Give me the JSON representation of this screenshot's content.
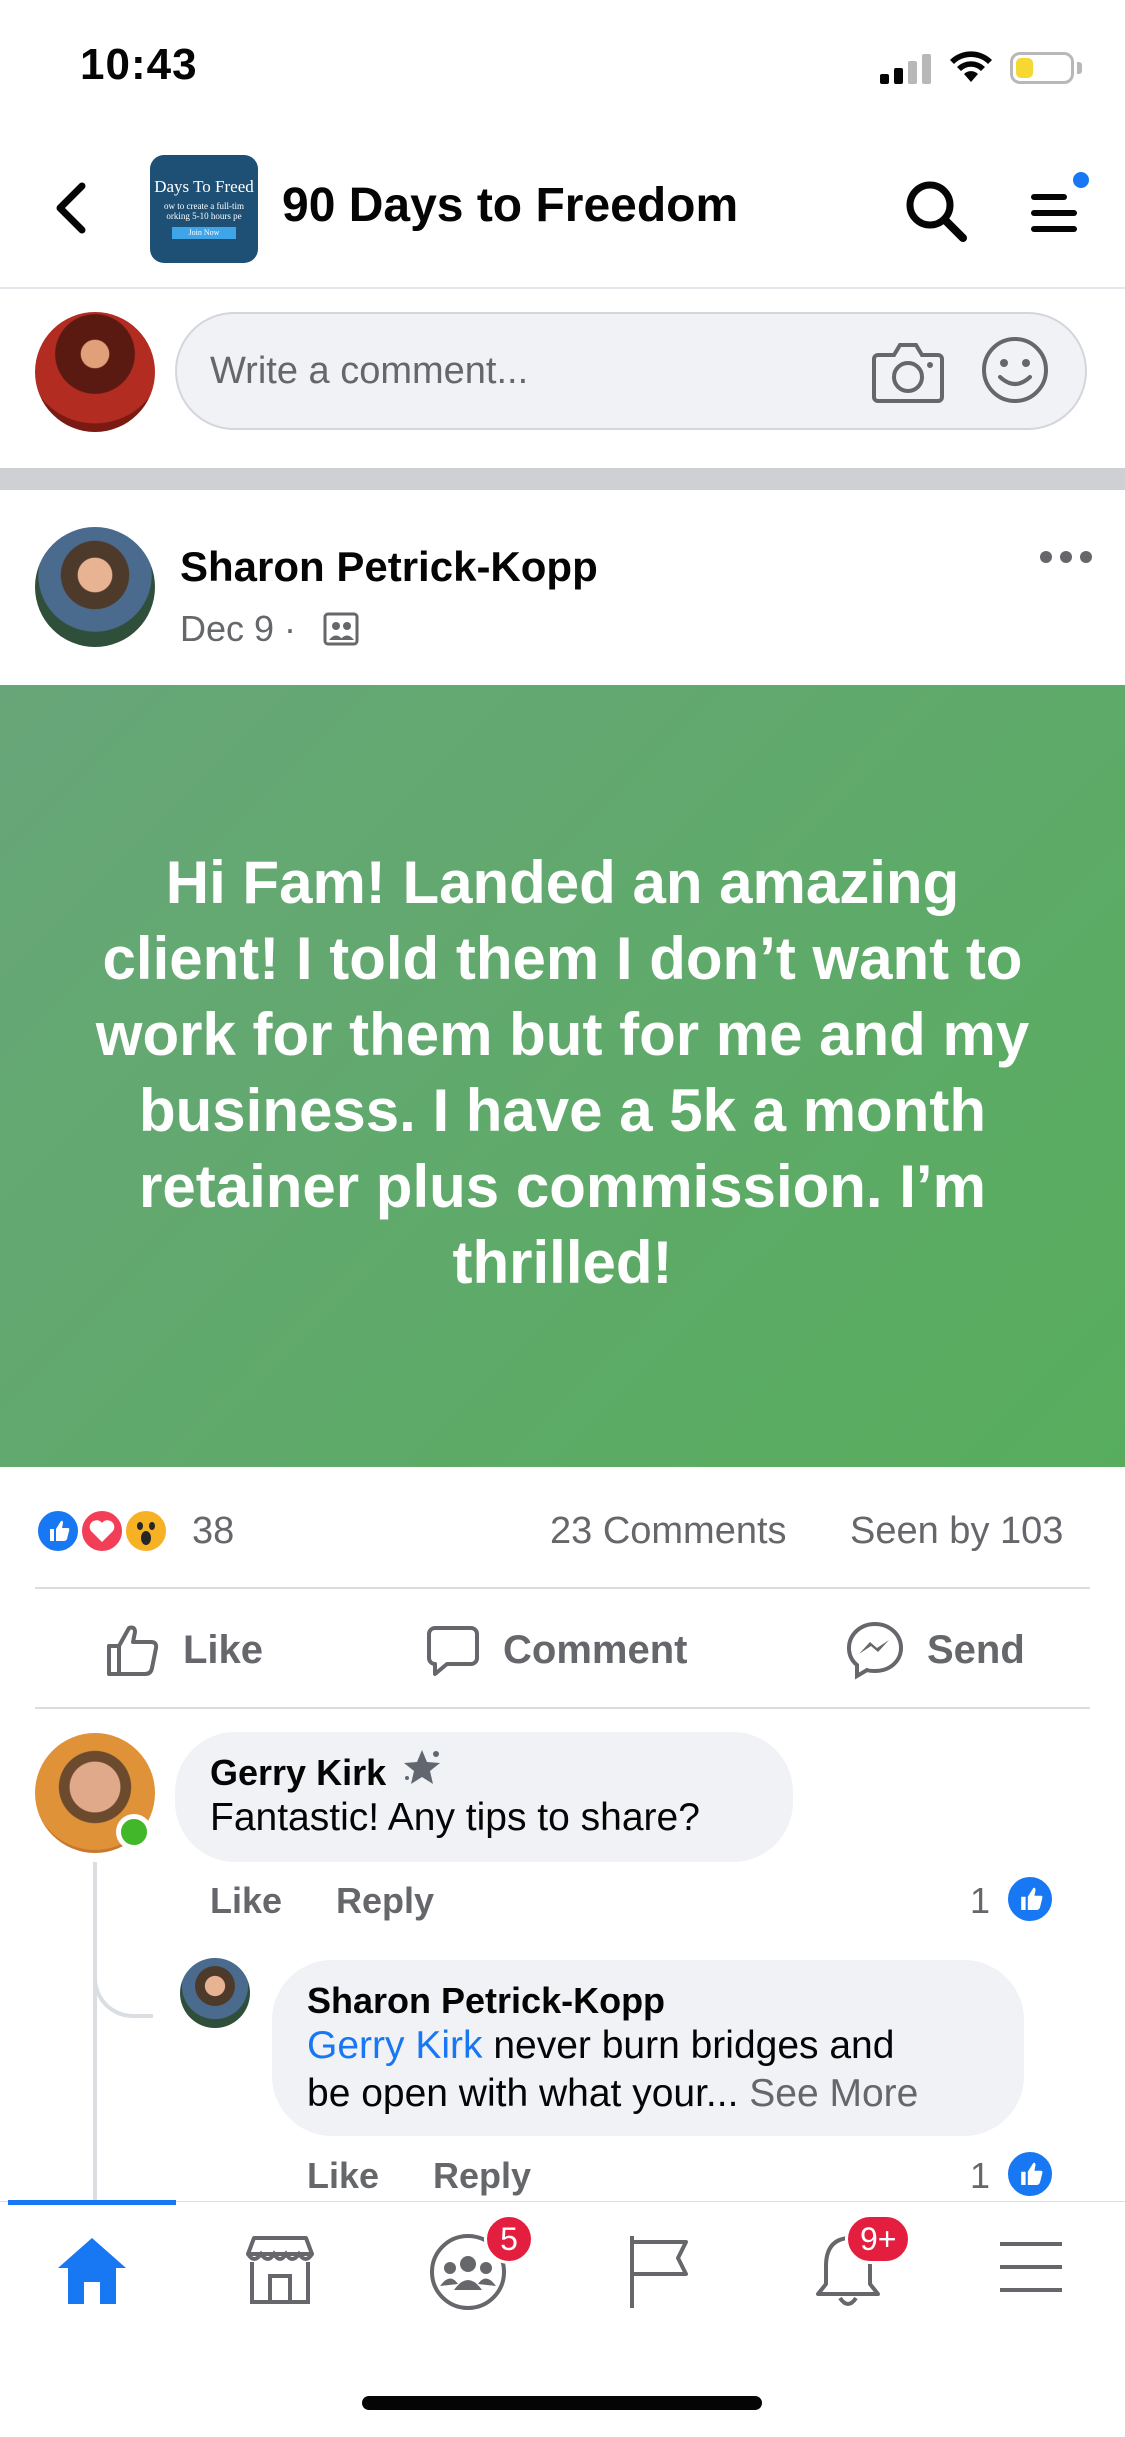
{
  "status_bar": {
    "time": "10:43",
    "battery_level": 0.3,
    "battery_color": "#f7d731"
  },
  "header": {
    "title": "90 Days to Freedom",
    "thumbnail": {
      "line1": "Days To Freed",
      "line2": "ow to create a full-tim",
      "line3": "orking 5-10 hours pe",
      "button": "Join Now"
    },
    "notification_dot_color": "#1877f2"
  },
  "composer": {
    "placeholder": "Write a comment..."
  },
  "post": {
    "author": "Sharon Petrick-Kopp",
    "date": "Dec 9 ·",
    "text": "Hi Fam! Landed an amazing client! I told them I don’t want to work for them but for me and my business. I have a 5k a month retainer plus commission. I’m thrilled!",
    "background_colors": [
      "#68a679",
      "#57ad5d"
    ],
    "reactions": [
      "like",
      "love",
      "wow"
    ],
    "reaction_count": "38",
    "comments_count": "23 Comments",
    "seen_by": "Seen by 103"
  },
  "actions": {
    "like": "Like",
    "comment": "Comment",
    "send": "Send"
  },
  "comments": [
    {
      "name": "Gerry Kirk",
      "text": "Fantastic! Any tips to share?",
      "like": "Like",
      "reply": "Reply",
      "like_count": "1",
      "online": true
    },
    {
      "name": "Sharon Petrick-Kopp",
      "mention": "Gerry Kirk",
      "text_line1": " never burn bridges and",
      "text_line2": "be open with what your... ",
      "see_more": "See More",
      "like": "Like",
      "reply": "Reply",
      "like_count": "1"
    }
  ],
  "tab_bar": {
    "tabs": [
      "home",
      "marketplace",
      "groups",
      "pages",
      "notifications",
      "menu"
    ],
    "active": "home",
    "groups_badge": "5",
    "notifications_badge": "9+",
    "accent": "#1877f2",
    "badge_color": "#e41e3f"
  }
}
